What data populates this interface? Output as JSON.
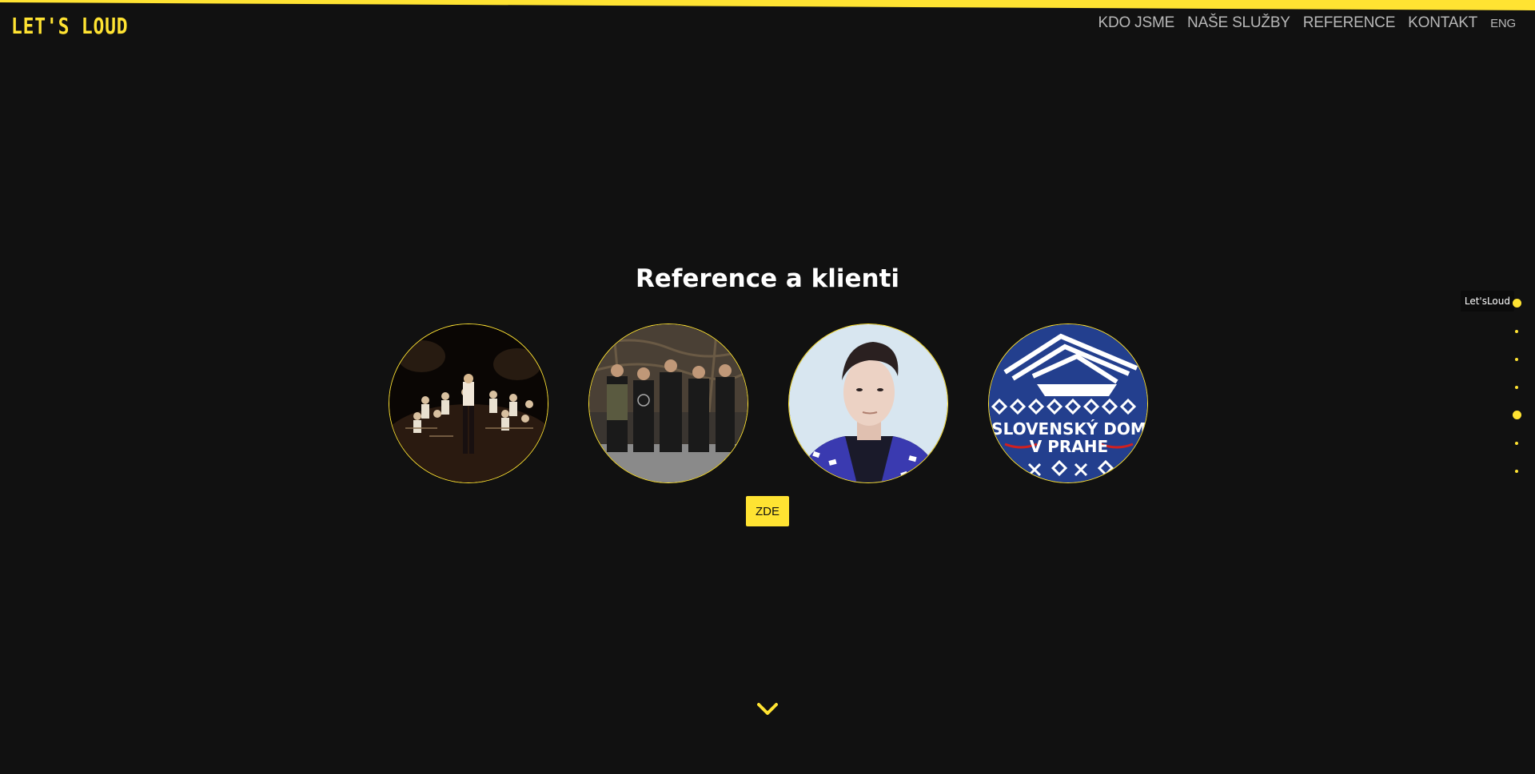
{
  "header": {
    "logo": "LET'S LOUD",
    "nav": [
      "KDO JSME",
      "NAŠE SLUŽBY",
      "REFERENCE",
      "KONTAKT"
    ],
    "lang": "ENG"
  },
  "main": {
    "title": "Reference a klienti",
    "references": [
      {
        "name": "orchestra-photo"
      },
      {
        "name": "band-photo"
      },
      {
        "name": "singer-portrait"
      },
      {
        "name": "Slovenský dom v Prahe logo",
        "logo_text_1": "SLOVENSKÝ DOM",
        "logo_text_2": "V PRAHE"
      }
    ],
    "cta_label": "ZDE"
  },
  "dot_nav": {
    "tooltip": "Let'sLoud",
    "count": 7,
    "active_indices": [
      0,
      4
    ]
  },
  "colors": {
    "accent": "#ffe332",
    "background": "#111111",
    "nav_text": "#b8b8b8"
  },
  "icons": {
    "scroll_down": "chevron-down-icon"
  }
}
